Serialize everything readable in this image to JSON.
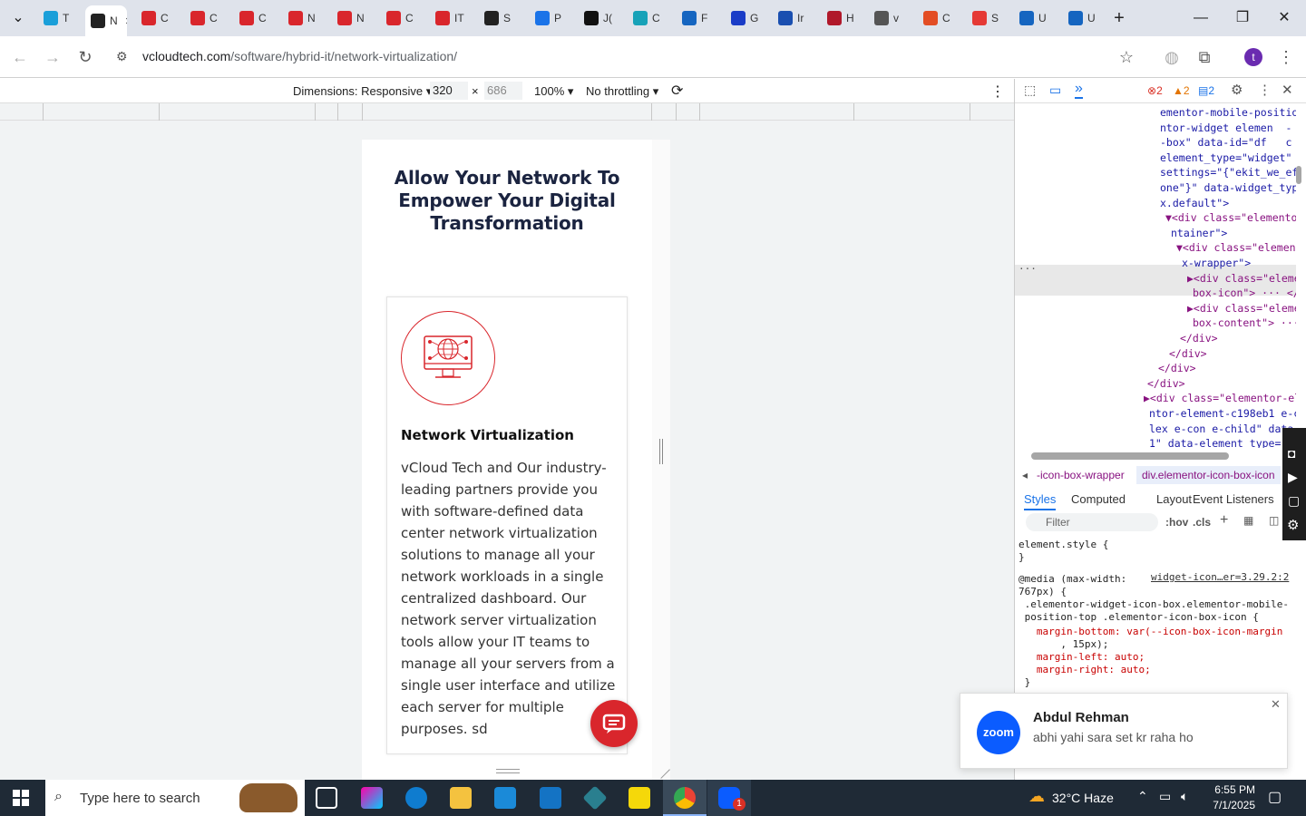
{
  "browser": {
    "tabs": [
      {
        "label": "T"
      },
      {
        "label": "N"
      },
      {
        "label": "C"
      },
      {
        "label": "C"
      },
      {
        "label": "C"
      },
      {
        "label": "N"
      },
      {
        "label": "N"
      },
      {
        "label": "C"
      },
      {
        "label": "IT"
      },
      {
        "label": "S"
      },
      {
        "label": "P"
      },
      {
        "label": "J("
      },
      {
        "label": "C"
      },
      {
        "label": "F"
      },
      {
        "label": "G"
      },
      {
        "label": "Ir"
      },
      {
        "label": "H"
      },
      {
        "label": "v"
      },
      {
        "label": "C"
      },
      {
        "label": "S"
      },
      {
        "label": "U"
      },
      {
        "label": "U"
      }
    ],
    "url_host": "vcloudtech.com",
    "url_path": "/software/hybrid-it/network-virtualization/",
    "profile_initial": "t"
  },
  "devtools_toolbar": {
    "dimensions_label": "Dimensions: Responsive",
    "width_value": "320",
    "height_value": "686",
    "times": "×",
    "zoom": "100%",
    "throttling": "No throttling"
  },
  "page": {
    "heading": "Allow Your Network To Empower Your Digital Transformation",
    "card_title": "Network Virtualization",
    "card_body": "vCloud Tech and Our industry-leading partners provide you with software-defined data center network virtualization solutions to manage all your network workloads in a single centralized dashboard. Our network server virtualization tools allow your IT teams to manage all your servers from a single user interface and utilize each server for multiple purposes.  sd"
  },
  "devtools_panel": {
    "errors": "2",
    "warnings": "2",
    "messages": "2",
    "elements_lines": [
      "ementor-mobile-positio",
      "ntor-widget elemen  -",
      "-box\" data-id=\"df   c",
      "element_type=\"widget\"",
      "settings=\"{\"ekit_we_ef",
      "one\"}\" data-widget_typ",
      "x.default\">",
      "▼<div class=\"elementor",
      "ntainer\">",
      "▼<div class=\"element",
      "x-wrapper\">",
      "▶<div class=\"eleme",
      "box-icon\"> ··· </di",
      "▶<div class=\"eleme",
      "box-content\"> ··· <",
      "</div>",
      "</div>",
      "</div>",
      "</div>",
      "▶<div class=\"elementor-el",
      "ntor-element-c198eb1 e-c",
      "lex e-con e-child\" data-",
      "1\" data-element_type=\""
    ],
    "breadcrumb_left": "-icon-box-wrapper",
    "breadcrumb_right": "div.elementor-icon-box-icon",
    "style_tabs": [
      "Styles",
      "Computed",
      "Layout",
      "Event Listeners"
    ],
    "filter_placeholder": "Filter",
    "hov": ":hov",
    "cls": ".cls",
    "style_lines": [
      "element.style {",
      "}",
      "@media (max-width:",
      "767px) {",
      " .elementor-widget-icon-box.elementor-mobile-",
      " position-top .elementor-icon-box-icon {",
      "   margin-bottom: var(--icon-box-icon-margin",
      "       , 15px);",
      "   margin-left: auto;",
      "   margin-right: auto;",
      " }"
    ],
    "style_source": "widget-icon…er=3.29.2:2"
  },
  "notification": {
    "app": "zoom",
    "sender": "Abdul Rehman",
    "message": "abhi yahi sara set kr raha ho"
  },
  "taskbar": {
    "search_placeholder": "Type here to search",
    "weather": "32°C  Haze",
    "time": "6:55 PM",
    "date": "7/1/2025",
    "zoom_badge": "1"
  }
}
